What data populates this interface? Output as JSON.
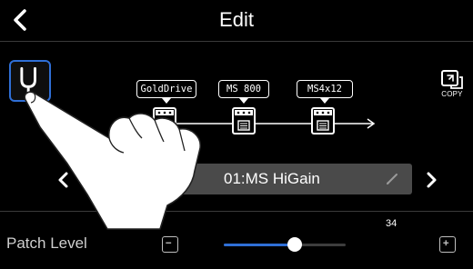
{
  "header": {
    "title": "Edit",
    "back_icon": "chevron-left-icon"
  },
  "tuner": {
    "icon": "tuning-fork-icon",
    "highlight_color": "#2f6fd6"
  },
  "copy": {
    "label": "COPY",
    "icon": "copy-icon"
  },
  "effects": [
    {
      "name": "GoldDrive"
    },
    {
      "name": "MS 800"
    },
    {
      "name": "MS4x12"
    }
  ],
  "patch": {
    "name": "01:MS HiGain"
  },
  "patch_level": {
    "label": "Patch Level",
    "value": "34",
    "fraction": 0.34
  },
  "colors": {
    "accent": "#2f6fd6",
    "background": "#000000",
    "patch_bg": "#4a4a4a"
  }
}
